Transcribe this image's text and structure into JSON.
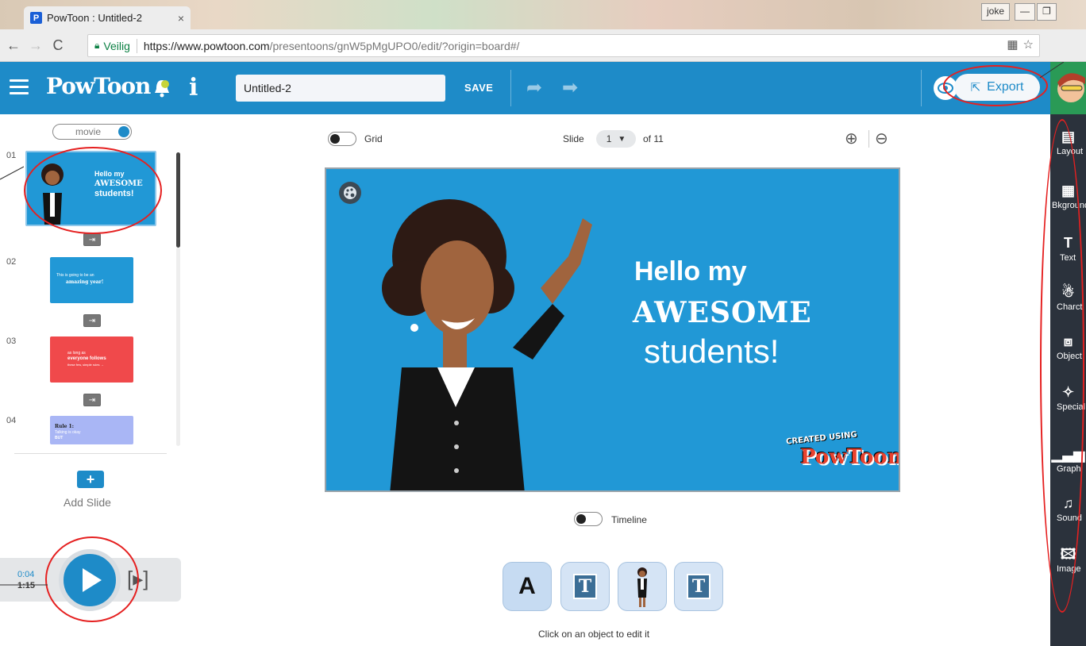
{
  "browser": {
    "tab_title": "PowToon : Untitled-2",
    "tab_favicon_letter": "P",
    "tab_close": "×",
    "window_user": "joke",
    "secure_label": "Veilig",
    "url_host": "https://www.powtoon.com",
    "url_path": "/presentoons/gnW5pMgUPO0/edit/?origin=board#/"
  },
  "header": {
    "logo_text": "PowToon",
    "info_symbol": "i",
    "title_value": "Untitled-2",
    "save_label": "SAVE",
    "export_label": "Export"
  },
  "left_panel": {
    "movie_toggle_label": "movie",
    "slide_numbers": [
      "01",
      "02",
      "03",
      "04"
    ],
    "thumbs": [
      {
        "line1": "Hello my",
        "line2": "AWESOME",
        "line3": "students!",
        "color": "#2198d6"
      },
      {
        "line1": "This is going to be an",
        "line2": "amazing year!",
        "color": "#2198d6"
      },
      {
        "line1": "as long as",
        "line2": "everyone follows",
        "line3": "these few, simple rules →",
        "color": "#f0494b"
      },
      {
        "line1": "Rule 1:",
        "line2": "Talking is okay",
        "line3": "BUT",
        "color": "#a9b6f5"
      }
    ],
    "add_slide_label": "Add Slide",
    "time_current": "0:04",
    "time_total": "1:15"
  },
  "canvas": {
    "grid_label": "Grid",
    "slide_label": "Slide",
    "slide_current": "1",
    "slide_of": "of 11",
    "stage_line1": "Hello my",
    "stage_line2": "AWESOME",
    "stage_line3": "students!",
    "watermark_small": "CREATED USING",
    "watermark_brand": "PowToon",
    "timeline_label": "Timeline",
    "object_hint": "Click on an object to edit it",
    "object_buttons": [
      "A",
      "T",
      "character",
      "T"
    ],
    "background_color": "#2198d6"
  },
  "toolbar": {
    "items": [
      {
        "label": "Layout",
        "icon": "layout-icon"
      },
      {
        "label": "Bkground",
        "icon": "background-icon"
      },
      {
        "label": "Text",
        "icon": "text-icon"
      },
      {
        "label": "Charct",
        "icon": "character-icon"
      },
      {
        "label": "Object",
        "icon": "object-icon"
      },
      {
        "label": "Special",
        "icon": "special-icon"
      },
      {
        "label": "Graph",
        "icon": "graph-icon"
      },
      {
        "label": "Sound",
        "icon": "sound-icon"
      },
      {
        "label": "Image",
        "icon": "image-icon"
      }
    ]
  },
  "colors": {
    "brand_blue": "#1e8bc8",
    "toolbar_dark": "#2b323c",
    "annotation_red": "#e52020"
  }
}
